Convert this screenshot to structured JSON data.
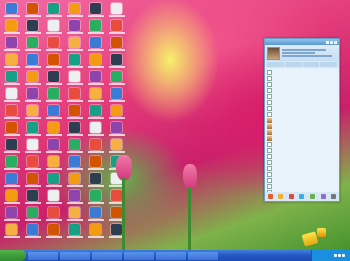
{
  "desktop": {
    "icon_columns": 6,
    "icon_rows": 14
  },
  "qq_window": {
    "title": "",
    "tabs": [
      "",
      "",
      "",
      ""
    ],
    "rows": [
      "",
      "",
      "",
      "",
      "",
      "",
      "",
      "",
      "",
      "",
      "",
      "",
      "",
      "",
      "",
      "",
      "",
      "",
      "",
      "",
      ""
    ]
  },
  "taskbar": {
    "start_label": "",
    "items": [
      "",
      "",
      "",
      "",
      "",
      ""
    ],
    "clock": ""
  },
  "colors": {
    "taskbar": "#2457c4",
    "start_button": "#3a9a36",
    "qq_window_bg": "#e8f2fb"
  }
}
